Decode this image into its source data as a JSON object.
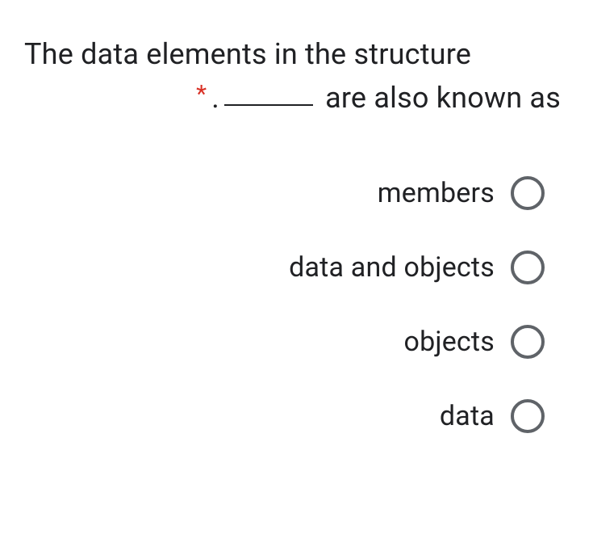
{
  "question": {
    "line1": "The data elements in the structure",
    "line2_prefix": ".",
    "line2_suffix": " are also known as",
    "required_marker": "*"
  },
  "options": [
    {
      "label": "members"
    },
    {
      "label": "data and objects"
    },
    {
      "label": "objects"
    },
    {
      "label": "data"
    }
  ]
}
